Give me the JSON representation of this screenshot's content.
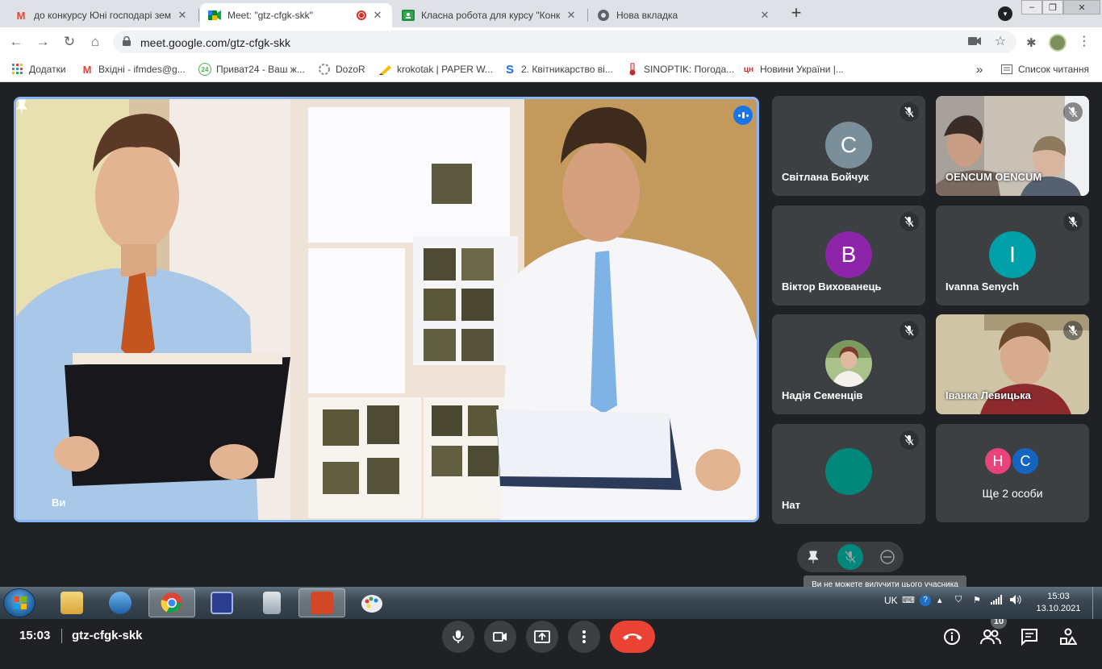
{
  "tabs": [
    {
      "title": "до конкурсу Юні господарі зем",
      "favicon": "gmail-icon"
    },
    {
      "title": "Meet: \"gtz-cfgk-skk\"",
      "favicon": "meet-icon",
      "active": true
    },
    {
      "title": "Класна робота для курсу \"Конку",
      "favicon": "classroom-icon"
    },
    {
      "title": "Нова вкладка",
      "favicon": "chrome-icon"
    }
  ],
  "address_bar": {
    "url": "meet.google.com/gtz-cfgk-skk"
  },
  "bookmarks": [
    {
      "label": "Додатки",
      "icon": "apps-grid-icon"
    },
    {
      "label": "Вхідні - ifmdes@g...",
      "icon": "gmail-icon"
    },
    {
      "label": "Приват24 - Ваш ж...",
      "icon": "privat24-icon",
      "icon_text": "24"
    },
    {
      "label": "DozoR",
      "icon": "dozor-icon"
    },
    {
      "label": "krokotak | PAPER W...",
      "icon": "pencil-icon"
    },
    {
      "label": "2. Квітникарство ві...",
      "icon": "s-icon",
      "icon_text": "S"
    },
    {
      "label": "SINOPTIK: Погода...",
      "icon": "thermometer-icon"
    },
    {
      "label": "Новини України |...",
      "icon": "tsn-icon",
      "icon_text": "цн"
    }
  ],
  "reading_list": "Список читання",
  "bookmarks_more": "»",
  "meet": {
    "main_tile": {
      "name": "Ви"
    },
    "participants": [
      {
        "name": "Світлана Бойчук",
        "initial": "C",
        "color": "#7a8f99",
        "muted": true
      },
      {
        "name": "OENCUM OENCUM",
        "video": true,
        "muted": true
      },
      {
        "name": "Віктор Вихованець",
        "initial": "B",
        "color": "#8e24aa",
        "muted": true
      },
      {
        "name": "Ivanna Senych",
        "initial": "I",
        "color": "#00a0a8",
        "muted": true
      },
      {
        "name": "Надія Семенців",
        "photo": true,
        "muted": true
      },
      {
        "name": "Іванка Левицька",
        "video": true,
        "muted": true
      },
      {
        "name": "Нат",
        "muted": true
      }
    ],
    "more": {
      "label": "Ще 2 особи",
      "initials": [
        "H",
        "C"
      ],
      "colors": [
        "#e8437a",
        "#1565c0"
      ]
    },
    "tooltip": "Ви не можете вилучити цього учасника",
    "time": "15:03",
    "code": "gtz-cfgk-skk",
    "people_count": "10"
  },
  "taskbar": {
    "language": "UK",
    "time": "15:03",
    "date": "13.10.2021"
  }
}
